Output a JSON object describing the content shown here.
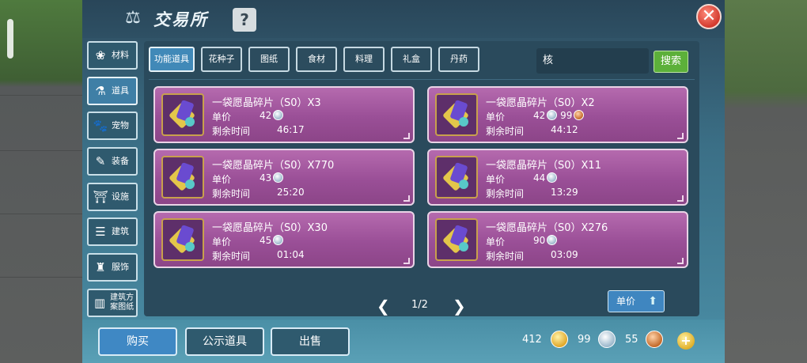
{
  "header": {
    "title": "交易所",
    "help": "?",
    "close": "✕"
  },
  "sidebar": {
    "items": [
      {
        "label": "材料",
        "icon": "materials-icon",
        "glyph": "❀"
      },
      {
        "label": "道具",
        "icon": "items-icon",
        "glyph": "⚗"
      },
      {
        "label": "宠物",
        "icon": "pet-paw-icon",
        "glyph": "🐾"
      },
      {
        "label": "装备",
        "icon": "equipment-icon",
        "glyph": "✎"
      },
      {
        "label": "设施",
        "icon": "facility-icon",
        "glyph": "⛩"
      },
      {
        "label": "建筑",
        "icon": "building-icon",
        "glyph": "☰"
      },
      {
        "label": "服饰",
        "icon": "clothing-icon",
        "glyph": "♜"
      },
      {
        "label": "建筑方案图纸",
        "icon": "blueprint-icon",
        "glyph": "▥"
      }
    ],
    "active_index": 1
  },
  "tabs": [
    {
      "label": "功能道具"
    },
    {
      "label": "花种子"
    },
    {
      "label": "图纸"
    },
    {
      "label": "食材"
    },
    {
      "label": "料理"
    },
    {
      "label": "礼盒"
    },
    {
      "label": "丹药"
    }
  ],
  "search": {
    "value": "核",
    "button": "搜索"
  },
  "listings": [
    {
      "name": "一袋愿晶碎片（S0）X3",
      "price_label": "单价",
      "price": "42",
      "extra": "",
      "time_label": "剩余时间",
      "time": "46:17"
    },
    {
      "name": "一袋愿晶碎片（S0）X2",
      "price_label": "单价",
      "price": "42",
      "extra": "99",
      "time_label": "剩余时间",
      "time": "44:12"
    },
    {
      "name": "一袋愿晶碎片（S0）X770",
      "price_label": "单价",
      "price": "43",
      "extra": "",
      "time_label": "剩余时间",
      "time": "25:20"
    },
    {
      "name": "一袋愿晶碎片（S0）X11",
      "price_label": "单价",
      "price": "44",
      "extra": "",
      "time_label": "剩余时间",
      "time": "13:29"
    },
    {
      "name": "一袋愿晶碎片（S0）X30",
      "price_label": "单价",
      "price": "45",
      "extra": "",
      "time_label": "剩余时间",
      "time": "01:04"
    },
    {
      "name": "一袋愿晶碎片（S0）X276",
      "price_label": "单价",
      "price": "90",
      "extra": "",
      "time_label": "剩余时间",
      "time": "03:09"
    }
  ],
  "pagination": {
    "page": "1/2",
    "prev": "❮",
    "next": "❯"
  },
  "sort": {
    "label": "单价",
    "arrow": "⬆"
  },
  "bottom": {
    "buy": "购买",
    "public_items": "公示道具",
    "sell": "出售",
    "gold": "412",
    "silver": "99",
    "bronze": "55",
    "add": "+"
  },
  "colors": {
    "card": "#9a4f97",
    "accent": "#3f88c4",
    "search_button": "#5cb03a",
    "close": "#d23a2e"
  }
}
